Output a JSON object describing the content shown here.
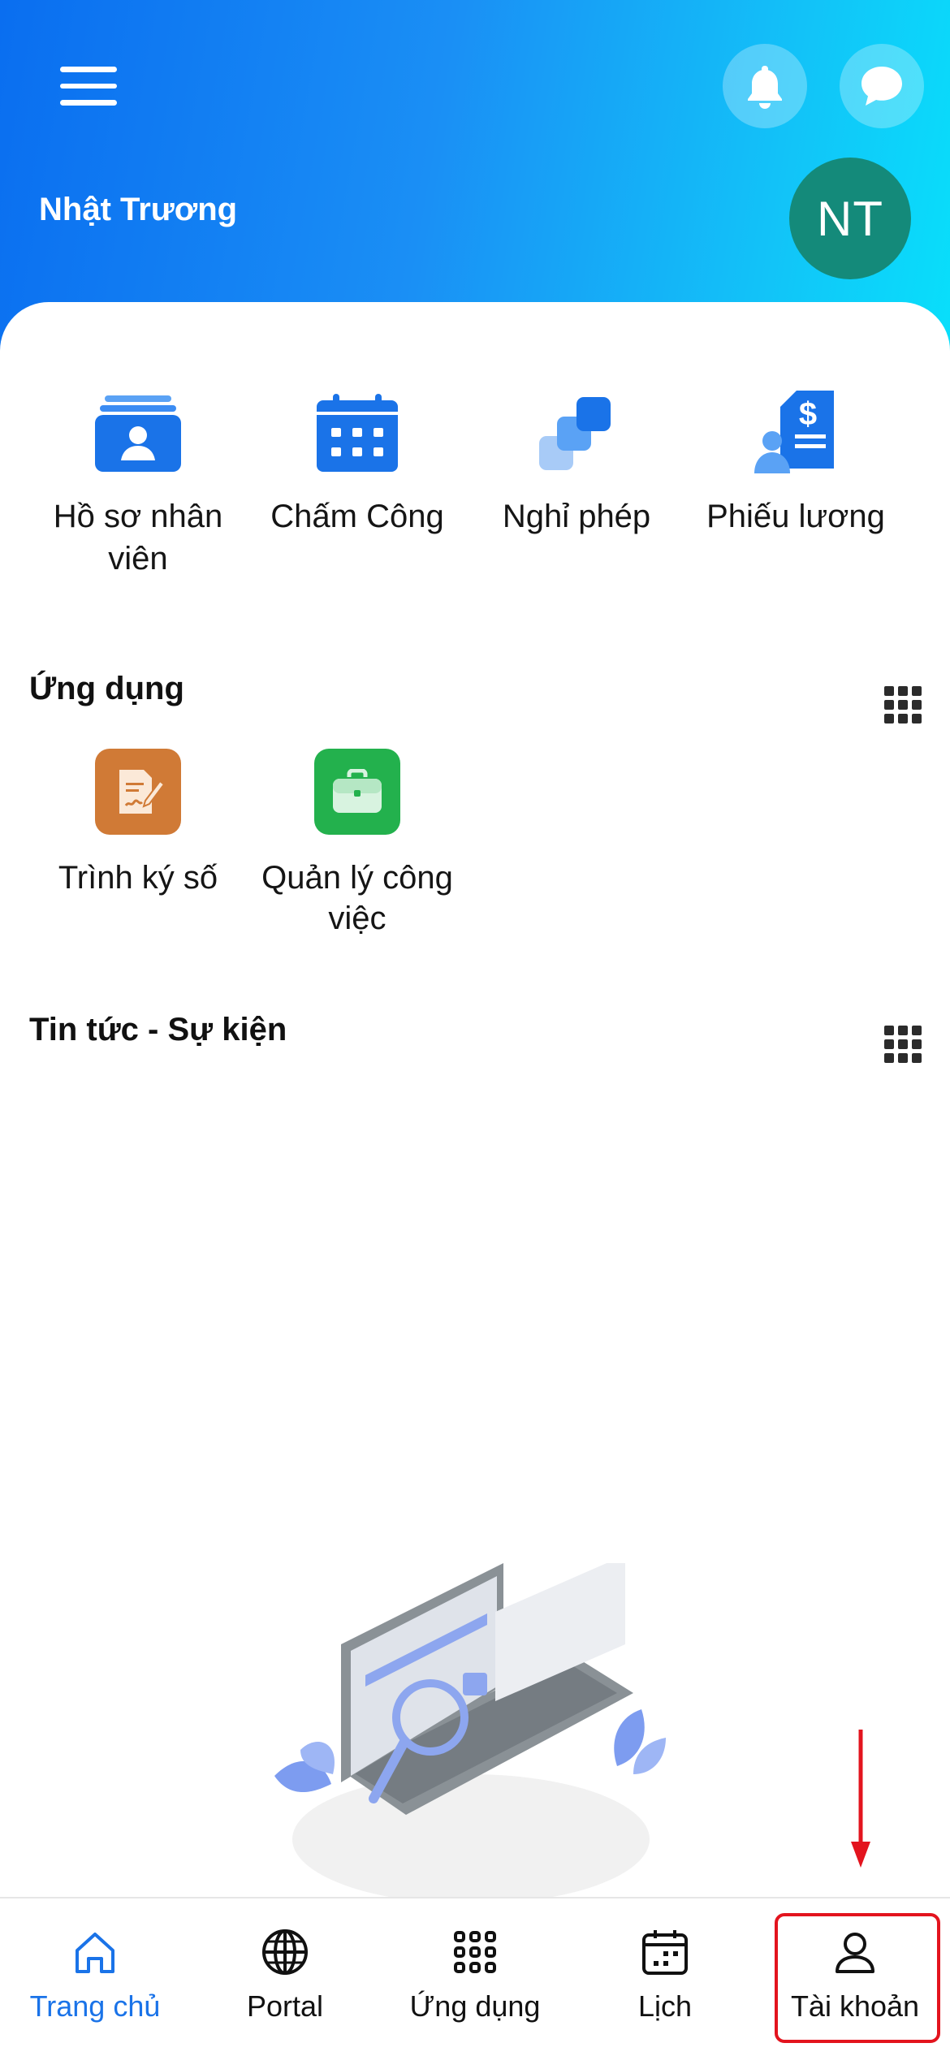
{
  "header": {
    "user_name": "Nhật Trương",
    "avatar_initials": "NT",
    "gradient_colors": [
      "#0a6ef0",
      "#08e0fb"
    ]
  },
  "quick_actions": [
    {
      "label": "Hồ sơ nhân viên",
      "icon": "employee-profile-icon"
    },
    {
      "label": "Chấm Công",
      "icon": "calendar-icon"
    },
    {
      "label": "Nghỉ phép",
      "icon": "leave-icon"
    },
    {
      "label": "Phiếu lương",
      "icon": "payslip-icon"
    }
  ],
  "apps_section": {
    "title": "Ứng dụng",
    "items": [
      {
        "label": "Trình ký số",
        "icon": "digital-signature-icon",
        "color": "#d07a36"
      },
      {
        "label": "Quản lý công việc",
        "icon": "briefcase-icon",
        "color": "#23b14d"
      }
    ]
  },
  "news_section": {
    "title": "Tin tức - Sự kiện"
  },
  "bottom_nav": {
    "active_color": "#1a73e8",
    "highlight_color": "#e3141e",
    "items": [
      {
        "label": "Trang chủ",
        "icon": "home-icon",
        "active": true
      },
      {
        "label": "Portal",
        "icon": "globe-icon",
        "active": false
      },
      {
        "label": "Ứng dụng",
        "icon": "apps-grid-icon",
        "active": false
      },
      {
        "label": "Lịch",
        "icon": "calendar-icon",
        "active": false
      },
      {
        "label": "Tài khoản",
        "icon": "user-icon",
        "active": false
      }
    ]
  }
}
